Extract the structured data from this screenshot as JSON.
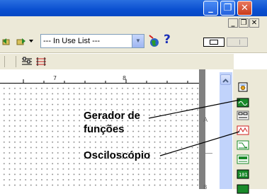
{
  "window": {
    "controls": {
      "minimize": "_",
      "maximize": "❐",
      "close": "✕"
    }
  },
  "mdi": {
    "minimize": "_",
    "restore": "❐",
    "close": "✕"
  },
  "toolbar": {
    "list_select": {
      "value": "--- In Use List ---"
    },
    "help": "?"
  },
  "ruler": {
    "ticks": [
      "7",
      "8"
    ]
  },
  "side_marker": "A",
  "side_marker2": "B",
  "annotations": {
    "function_generator": {
      "line1": "Gerador de",
      "line2": "funções"
    },
    "oscilloscope": "Osciloscópio"
  },
  "colors": {
    "titlebar": "#0a4fd0",
    "panel": "#ece9d8",
    "scroll": "#c1d3fb"
  }
}
